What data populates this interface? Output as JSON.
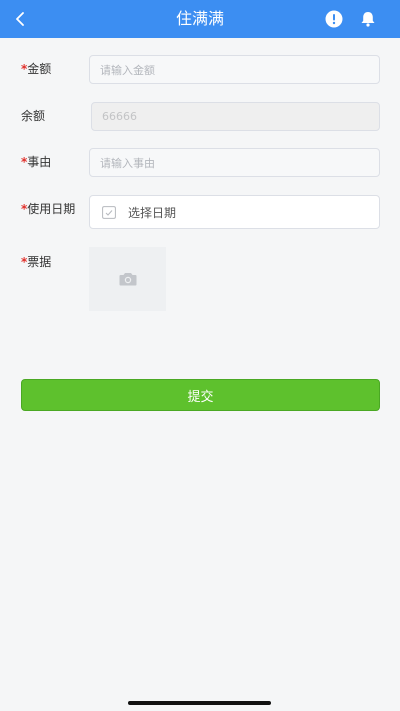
{
  "header": {
    "title": "住满满",
    "back_icon": "chevron-left-icon",
    "alert_icon": "exclamation-circle-icon",
    "bell_icon": "bell-icon"
  },
  "form": {
    "required_mark": "*",
    "amount": {
      "label": "金额",
      "placeholder": "请输入金额"
    },
    "balance": {
      "label": "余额",
      "value": "66666"
    },
    "reason": {
      "label": "事由",
      "placeholder": "请输入事由"
    },
    "date": {
      "label": "使用日期",
      "placeholder": "选择日期",
      "icon": "calendar-icon"
    },
    "receipt": {
      "label": "票据",
      "icon": "camera-icon"
    }
  },
  "submit": {
    "label": "提交"
  },
  "colors": {
    "header": "#3c8ef2",
    "required": "#e0302b",
    "submit": "#5ec12d"
  }
}
